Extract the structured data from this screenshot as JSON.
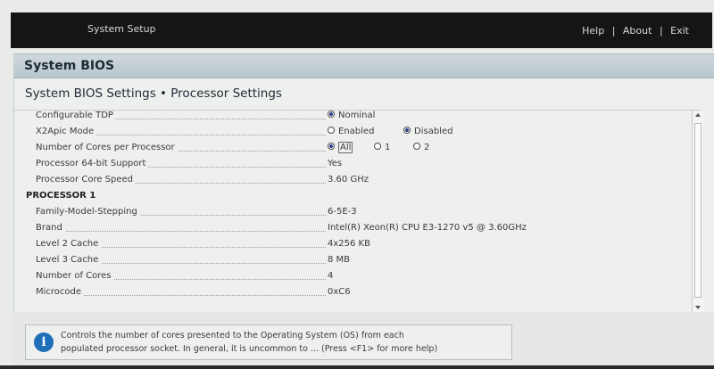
{
  "topbar": {
    "app_title": "System Setup",
    "menu": [
      "Help",
      "About",
      "Exit"
    ],
    "separator": "|"
  },
  "header": {
    "title": "System BIOS"
  },
  "main": {
    "section_title": "System BIOS Settings • Processor Settings",
    "settings": [
      {
        "label": "Configurable TDP",
        "options": [
          "Nominal"
        ],
        "selected": "Nominal"
      },
      {
        "label": "X2Apic Mode",
        "options": [
          "Enabled",
          "Disabled"
        ],
        "selected": "Disabled"
      },
      {
        "label": "Number of Cores per Processor",
        "options": [
          "All",
          "1",
          "2"
        ],
        "selected": "All"
      },
      {
        "label": "Processor 64-bit Support",
        "value": "Yes"
      },
      {
        "label": "Processor Core Speed",
        "value": "3.60 GHz"
      }
    ],
    "processor_header": "PROCESSOR 1",
    "processor_rows": [
      {
        "label": "Family-Model-Stepping",
        "value": "6-5E-3"
      },
      {
        "label": "Brand",
        "value": "Intel(R) Xeon(R) CPU E3-1270 v5 @ 3.60GHz"
      },
      {
        "label": "Level 2 Cache",
        "value": "4x256 KB"
      },
      {
        "label": "Level 3 Cache",
        "value": "8 MB"
      },
      {
        "label": "Number of Cores",
        "value": "4"
      },
      {
        "label": "Microcode",
        "value": "0xC6"
      }
    ]
  },
  "help": {
    "icon": "info-icon",
    "line1": "Controls the number of cores presented to the Operating System (OS) from each",
    "line2": "populated processor socket. In general, it is uncommon to ... (Press <F1> for more help)"
  },
  "colors": {
    "topbar_bg": "#151515",
    "header_band": "#c4cfd5",
    "radio_selected": "#2a3d87",
    "info_icon": "#1f6fb8"
  }
}
